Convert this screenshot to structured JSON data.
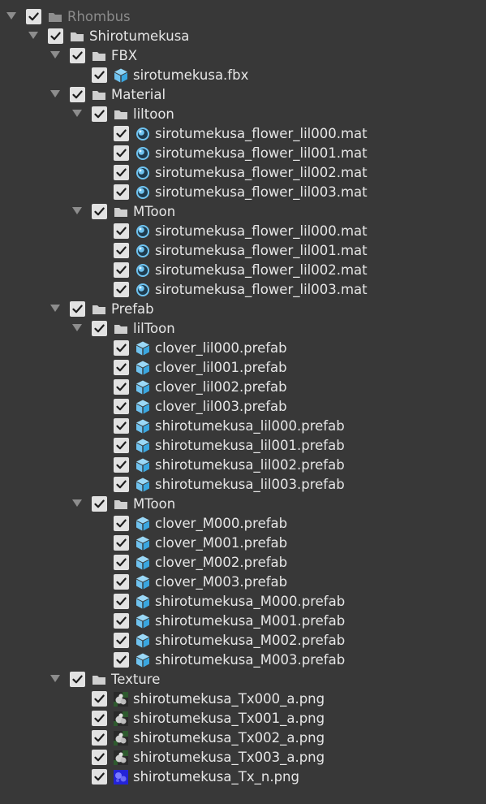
{
  "tree": [
    {
      "label": "Rhombus",
      "level": 0,
      "type": "folder",
      "expanded": true,
      "checked": true,
      "disabled": true
    },
    {
      "label": "Shirotumekusa",
      "level": 1,
      "type": "folder",
      "expanded": true,
      "checked": true
    },
    {
      "label": "FBX",
      "level": 2,
      "type": "folder",
      "expanded": true,
      "checked": true
    },
    {
      "label": "sirotumekusa.fbx",
      "level": 3,
      "type": "fbx",
      "checked": true
    },
    {
      "label": "Material",
      "level": 2,
      "type": "folder",
      "expanded": true,
      "checked": true
    },
    {
      "label": "liltoon",
      "level": 3,
      "type": "folder",
      "expanded": true,
      "checked": true
    },
    {
      "label": "sirotumekusa_flower_lil000.mat",
      "level": 4,
      "type": "material",
      "checked": true
    },
    {
      "label": "sirotumekusa_flower_lil001.mat",
      "level": 4,
      "type": "material",
      "checked": true
    },
    {
      "label": "sirotumekusa_flower_lil002.mat",
      "level": 4,
      "type": "material",
      "checked": true
    },
    {
      "label": "sirotumekusa_flower_lil003.mat",
      "level": 4,
      "type": "material",
      "checked": true
    },
    {
      "label": "MToon",
      "level": 3,
      "type": "folder",
      "expanded": true,
      "checked": true
    },
    {
      "label": "sirotumekusa_flower_lil000.mat",
      "level": 4,
      "type": "material",
      "checked": true
    },
    {
      "label": "sirotumekusa_flower_lil001.mat",
      "level": 4,
      "type": "material",
      "checked": true
    },
    {
      "label": "sirotumekusa_flower_lil002.mat",
      "level": 4,
      "type": "material",
      "checked": true
    },
    {
      "label": "sirotumekusa_flower_lil003.mat",
      "level": 4,
      "type": "material",
      "checked": true
    },
    {
      "label": "Prefab",
      "level": 2,
      "type": "folder",
      "expanded": true,
      "checked": true
    },
    {
      "label": "lilToon",
      "level": 3,
      "type": "folder",
      "expanded": true,
      "checked": true
    },
    {
      "label": "clover_lil000.prefab",
      "level": 4,
      "type": "prefab",
      "checked": true
    },
    {
      "label": "clover_lil001.prefab",
      "level": 4,
      "type": "prefab",
      "checked": true
    },
    {
      "label": "clover_lil002.prefab",
      "level": 4,
      "type": "prefab",
      "checked": true
    },
    {
      "label": "clover_lil003.prefab",
      "level": 4,
      "type": "prefab",
      "checked": true
    },
    {
      "label": "shirotumekusa_lil000.prefab",
      "level": 4,
      "type": "prefab",
      "checked": true
    },
    {
      "label": "shirotumekusa_lil001.prefab",
      "level": 4,
      "type": "prefab",
      "checked": true
    },
    {
      "label": "shirotumekusa_lil002.prefab",
      "level": 4,
      "type": "prefab",
      "checked": true
    },
    {
      "label": "shirotumekusa_lil003.prefab",
      "level": 4,
      "type": "prefab",
      "checked": true
    },
    {
      "label": "MToon",
      "level": 3,
      "type": "folder",
      "expanded": true,
      "checked": true
    },
    {
      "label": "clover_M000.prefab",
      "level": 4,
      "type": "prefab",
      "checked": true
    },
    {
      "label": "clover_M001.prefab",
      "level": 4,
      "type": "prefab",
      "checked": true
    },
    {
      "label": "clover_M002.prefab",
      "level": 4,
      "type": "prefab",
      "checked": true
    },
    {
      "label": "clover_M003.prefab",
      "level": 4,
      "type": "prefab",
      "checked": true
    },
    {
      "label": "shirotumekusa_M000.prefab",
      "level": 4,
      "type": "prefab",
      "checked": true
    },
    {
      "label": "shirotumekusa_M001.prefab",
      "level": 4,
      "type": "prefab",
      "checked": true
    },
    {
      "label": "shirotumekusa_M002.prefab",
      "level": 4,
      "type": "prefab",
      "checked": true
    },
    {
      "label": "shirotumekusa_M003.prefab",
      "level": 4,
      "type": "prefab",
      "checked": true
    },
    {
      "label": "Texture",
      "level": 2,
      "type": "folder",
      "expanded": true,
      "checked": true
    },
    {
      "label": "shirotumekusa_Tx000_a.png",
      "level": 3,
      "type": "texture",
      "checked": true
    },
    {
      "label": "shirotumekusa_Tx001_a.png",
      "level": 3,
      "type": "texture",
      "checked": true
    },
    {
      "label": "shirotumekusa_Tx002_a.png",
      "level": 3,
      "type": "texture",
      "checked": true
    },
    {
      "label": "shirotumekusa_Tx003_a.png",
      "level": 3,
      "type": "texture",
      "checked": true
    },
    {
      "label": "shirotumekusa_Tx_n.png",
      "level": 3,
      "type": "normal-texture",
      "checked": true
    }
  ],
  "colors": {
    "background": "#383838",
    "text": "#e6e6e6",
    "disabled_text": "#8b8b8b",
    "checkbox": "#e2e2e2",
    "folder": "#cfcfcf",
    "folder_disabled": "#8e8e8e",
    "asset_blue": "#6fc3f0"
  }
}
